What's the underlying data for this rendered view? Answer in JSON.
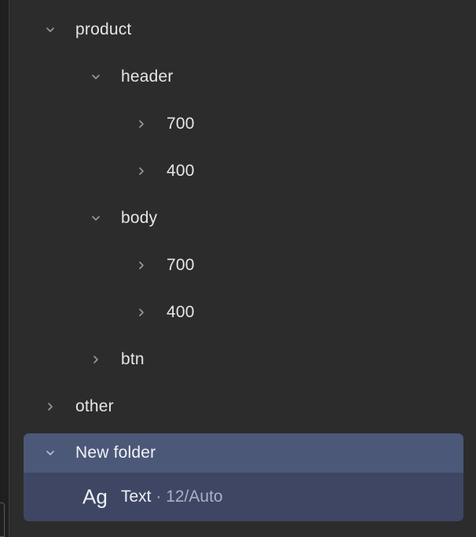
{
  "tree": {
    "rows": [
      {
        "label": "product",
        "expanded": true,
        "icon": "chevron-down-icon"
      },
      {
        "label": "header",
        "expanded": true,
        "icon": "chevron-down-icon"
      },
      {
        "label": "700",
        "expanded": false,
        "icon": "chevron-right-icon"
      },
      {
        "label": "400",
        "expanded": false,
        "icon": "chevron-right-icon"
      },
      {
        "label": "body",
        "expanded": true,
        "icon": "chevron-down-icon"
      },
      {
        "label": "700",
        "expanded": false,
        "icon": "chevron-right-icon"
      },
      {
        "label": "400",
        "expanded": false,
        "icon": "chevron-right-icon"
      },
      {
        "label": "btn",
        "expanded": false,
        "icon": "chevron-right-icon"
      },
      {
        "label": "other",
        "expanded": false,
        "icon": "chevron-right-icon"
      }
    ],
    "selected_folder": {
      "label": "New folder",
      "expanded": true,
      "icon": "chevron-down-icon",
      "style_item": {
        "preview": "Ag",
        "name": "Text",
        "separator": " · ",
        "meta": "12/Auto"
      }
    }
  },
  "colors": {
    "background": "#2c2c2c",
    "text": "#e6e6e6",
    "chevron": "#9a9a9a",
    "selection_header": "#4c5878",
    "selection_body": "#3e4663"
  }
}
